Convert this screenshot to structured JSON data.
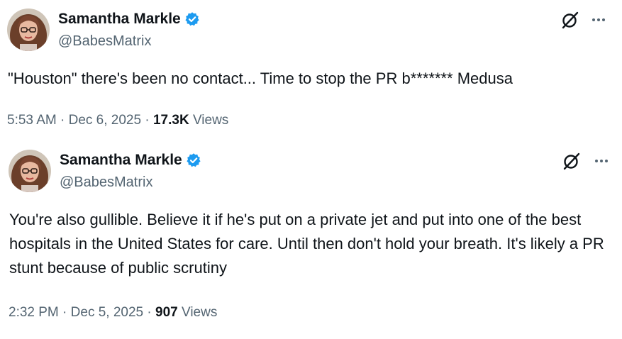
{
  "tweets": [
    {
      "author": {
        "display_name": "Samantha Markle",
        "handle": "@BabesMatrix",
        "verified": true,
        "avatar_icon": "avatar-photo"
      },
      "text": "\"Houston\" there's been no contact... Time to stop the PR b******* Medusa",
      "time": "5:53 AM",
      "sep1": "·",
      "date": "Dec 6, 2025",
      "sep2": "·",
      "views_count": "17.3K",
      "views_label": "Views",
      "grok_icon": "grok-icon",
      "more_icon": "more-icon"
    },
    {
      "author": {
        "display_name": "Samantha Markle",
        "handle": "@BabesMatrix",
        "verified": true,
        "avatar_icon": "avatar-photo"
      },
      "text": "You're also gullible. Believe it if he's put on a private jet and put into one of the best hospitals in the United States for care. Until then don't hold your breath. It's likely a PR stunt because of public scrutiny",
      "time": "2:32 PM",
      "sep1": "·",
      "date": "Dec 5, 2025",
      "sep2": "·",
      "views_count": "907",
      "views_label": "Views",
      "grok_icon": "grok-icon",
      "more_icon": "more-icon"
    }
  ],
  "colors": {
    "primary_text": "#0f1419",
    "secondary_text": "#536471",
    "verified_blue": "#1d9bf0",
    "background": "#ffffff"
  }
}
